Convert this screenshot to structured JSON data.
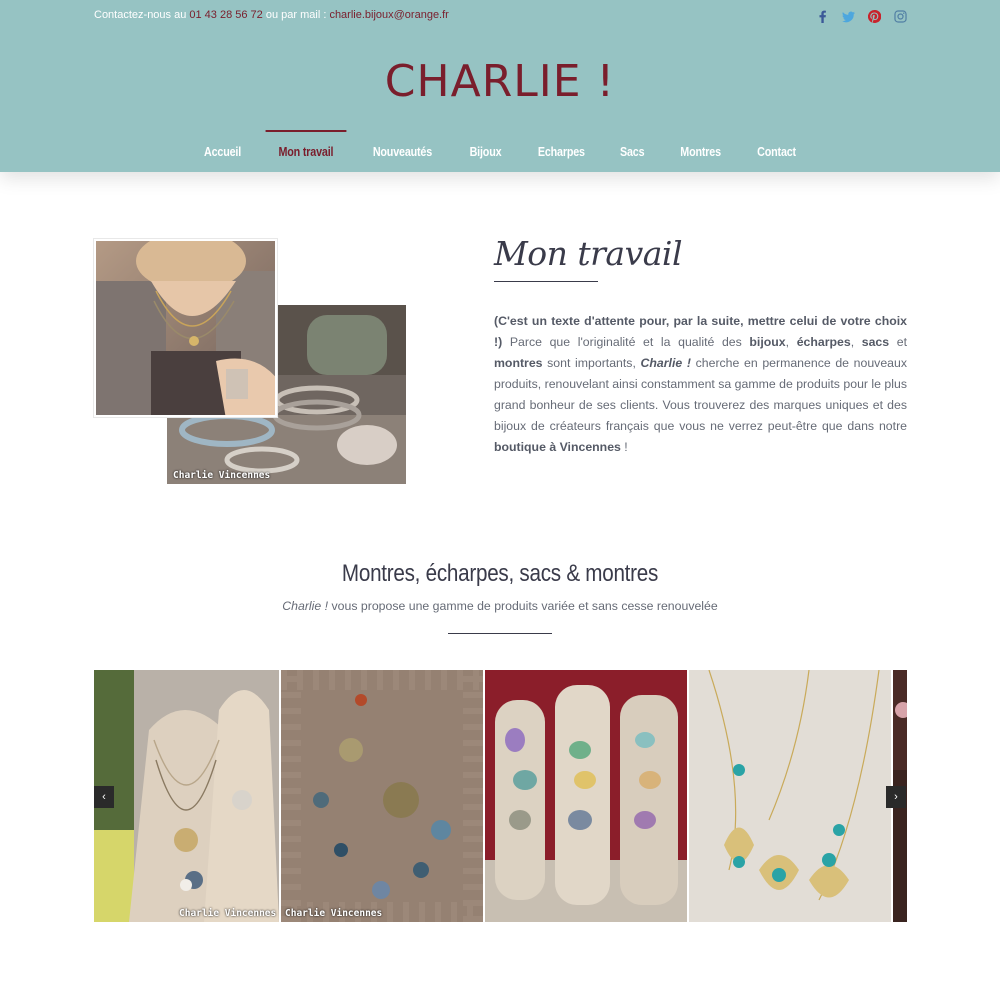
{
  "topbar": {
    "prefix": "Contactez-nous au ",
    "phone": "01 43 28 56 72",
    "middle": " ou par mail : ",
    "email": "charlie.bijoux@orange.fr"
  },
  "socials": [
    {
      "icon": "facebook-icon",
      "color": "#3b5998"
    },
    {
      "icon": "twitter-icon",
      "color": "#4da7de"
    },
    {
      "icon": "pinterest-icon",
      "color": "#c8232c"
    },
    {
      "icon": "instagram-icon",
      "color": "#517fa4"
    }
  ],
  "logo": "CHARLIE !",
  "nav": {
    "items": [
      "Accueil",
      "Mon travail",
      "Nouveautés",
      "Bijoux",
      "Echarpes",
      "Sacs",
      "Montres",
      "Contact"
    ],
    "active": "Mon travail"
  },
  "colors": {
    "header_bg": "#96c3c3",
    "accent": "#7a1e2c",
    "heading": "#3a3b4a"
  },
  "section": {
    "title": "Mon travail",
    "image_watermark": "Charlie Vincennes",
    "paragraph": {
      "p1": "(C'est un texte d'attente pour, par la suite, mettre celui de votre choix !)",
      "p2": " Parce que l'originalité et la qualité des ",
      "b1": "bijoux",
      "p3": ", ",
      "b2": "écharpes",
      "p4": ", ",
      "b3": "sacs",
      "p5": " et ",
      "b4": "montres",
      "p6": " sont importants, ",
      "b5": "Charlie !",
      "p7": " cherche en permanence de nouveaux produits, renouvelant ainsi constamment sa gamme de produits pour le plus grand bonheur de ses clients. Vous trouverez des marques uniques et des bijoux de créateurs français que vous ne verrez peut-être que dans notre ",
      "b6": "boutique à Vincennes",
      "p8": " !"
    }
  },
  "section2": {
    "title": "Montres, écharpes, sacs & montres",
    "subtitle_em": "Charlie !",
    "subtitle_rest": " vous propose une gamme de produits variée et sans cesse renouvelée"
  },
  "gallery": {
    "watermarks": [
      "Charlie Vincennes",
      "Charlie Vincennes"
    ],
    "prev": "‹",
    "next": "›"
  }
}
